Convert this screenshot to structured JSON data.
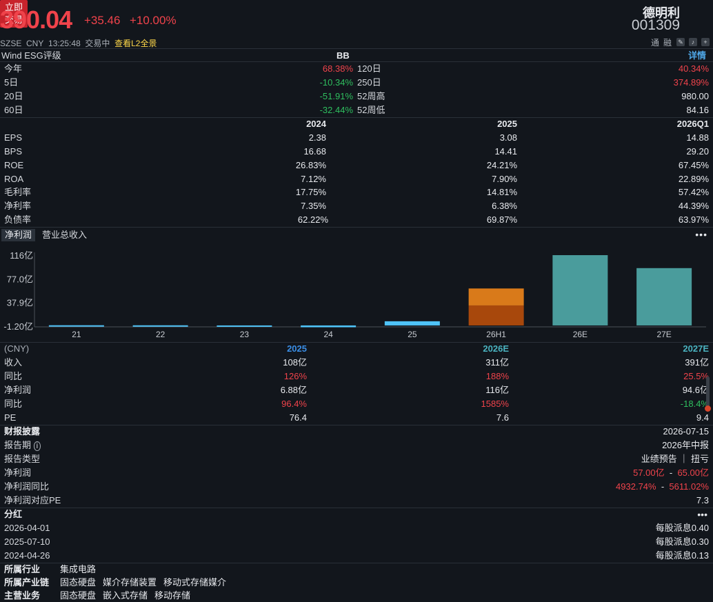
{
  "header": {
    "price": "390.04",
    "change": "+35.46",
    "change_pct": "+10.00%",
    "exchange": "SZSE",
    "currency": "CNY",
    "time": "13:25:48",
    "status": "交易中",
    "l2_link": "查看L2全景",
    "name": "德明利",
    "code": "001309",
    "trade_btn_line1": "立即",
    "trade_btn_line2": "交易",
    "tb_tong": "通",
    "tb_rong": "融"
  },
  "esg": {
    "label": "Wind ESG评级",
    "rating": "BB",
    "detail_link": "详情"
  },
  "returns": [
    {
      "l1": "今年",
      "v1": "68.38%",
      "c1": "red",
      "l2": "120日",
      "v2": "40.34%",
      "c2": "red"
    },
    {
      "l1": "5日",
      "v1": "-10.34%",
      "c1": "green",
      "l2": "250日",
      "v2": "374.89%",
      "c2": "red"
    },
    {
      "l1": "20日",
      "v1": "-51.91%",
      "c1": "green",
      "l2": "52周高",
      "v2": "980.00",
      "c2": "white"
    },
    {
      "l1": "60日",
      "v1": "-32.44%",
      "c1": "green",
      "l2": "52周低",
      "v2": "84.16",
      "c2": "white"
    }
  ],
  "fin": {
    "headers": [
      "2024",
      "2025",
      "2026Q1"
    ],
    "rows": [
      {
        "label": "EPS",
        "vals": [
          "2.38",
          "3.08",
          "14.88"
        ]
      },
      {
        "label": "BPS",
        "vals": [
          "16.68",
          "14.41",
          "29.20"
        ]
      },
      {
        "label": "ROE",
        "vals": [
          "26.83%",
          "24.21%",
          "67.45%"
        ]
      },
      {
        "label": "ROA",
        "vals": [
          "7.12%",
          "7.90%",
          "22.89%"
        ]
      },
      {
        "label": "毛利率",
        "vals": [
          "17.75%",
          "14.81%",
          "57.42%"
        ]
      },
      {
        "label": "净利率",
        "vals": [
          "7.35%",
          "6.38%",
          "44.39%"
        ]
      },
      {
        "label": "负债率",
        "vals": [
          "62.22%",
          "69.87%",
          "63.97%"
        ]
      }
    ]
  },
  "chart_tabs": {
    "active": "净利润",
    "other": "营业总收入",
    "more": "•••"
  },
  "chart_data": {
    "type": "bar",
    "categories": [
      "21",
      "22",
      "23",
      "24",
      "25",
      "26H1",
      "26E",
      "27E"
    ],
    "values": [
      0.3,
      0.2,
      -1.0,
      -3.0,
      6.9,
      61.0,
      116.0,
      94.6
    ],
    "ytick_labels": [
      "116亿",
      "77.0亿",
      "37.9亿",
      "-1.20亿"
    ],
    "yticks": [
      116,
      77.0,
      37.9,
      -1.2
    ],
    "ylim": [
      -1.2,
      116
    ],
    "colors": {
      "actual": "#4fc3f7",
      "h1_top": "#d97a1a",
      "h1_bottom": "#a8480c",
      "estimate": "#4a9c9c"
    },
    "h1_split": 33.0
  },
  "forecast": {
    "currency": "(CNY)",
    "headers": [
      {
        "text": "2025",
        "color": "blue"
      },
      {
        "text": "2026E",
        "color": "teal"
      },
      {
        "text": "2027E",
        "color": "teal"
      }
    ],
    "rows": [
      {
        "label": "收入",
        "vals": [
          "108亿",
          "311亿",
          "391亿"
        ],
        "colors": [
          "white",
          "white",
          "white"
        ]
      },
      {
        "label": "同比",
        "vals": [
          "126%",
          "188%",
          "25.5%"
        ],
        "colors": [
          "red",
          "red",
          "red"
        ]
      },
      {
        "label": "净利润",
        "vals": [
          "6.88亿",
          "116亿",
          "94.6亿"
        ],
        "colors": [
          "white",
          "white",
          "white"
        ]
      },
      {
        "label": "同比",
        "vals": [
          "96.4%",
          "1585%",
          "-18.4%"
        ],
        "colors": [
          "red",
          "red",
          "green"
        ]
      },
      {
        "label": "PE",
        "vals": [
          "76.4",
          "7.6",
          "9.4"
        ],
        "colors": [
          "white",
          "white",
          "white"
        ]
      }
    ]
  },
  "report": {
    "title": "财报披露",
    "date": "2026-07-15",
    "period_label": "报告期",
    "period_value": "2026年中报",
    "type_label": "报告类型",
    "type_value": "业绩预告 ｜ 扭亏",
    "np_label": "净利润",
    "np_low": "57.00亿",
    "np_sep": "-",
    "np_high": "65.00亿",
    "yoy_label": "净利润同比",
    "yoy_low": "4932.74%",
    "yoy_sep": "-",
    "yoy_high": "5611.02%",
    "pe_label": "净利润对应PE",
    "pe_value": "7.3"
  },
  "dividend": {
    "title": "分红",
    "more": "•••",
    "items": [
      {
        "date": "2026-04-01",
        "text": "每股派息0.40"
      },
      {
        "date": "2025-07-10",
        "text": "每股派息0.30"
      },
      {
        "date": "2024-04-26",
        "text": "每股派息0.13"
      }
    ]
  },
  "profile": {
    "industry_label": "所属行业",
    "industry": [
      "集成电路"
    ],
    "chain_label": "所属产业链",
    "chain": [
      "固态硬盘",
      "媒介存储装置",
      "移动式存储媒介"
    ],
    "business_label": "主营业务",
    "business": [
      "固态硬盘",
      "嵌入式存储",
      "移动存储"
    ]
  }
}
